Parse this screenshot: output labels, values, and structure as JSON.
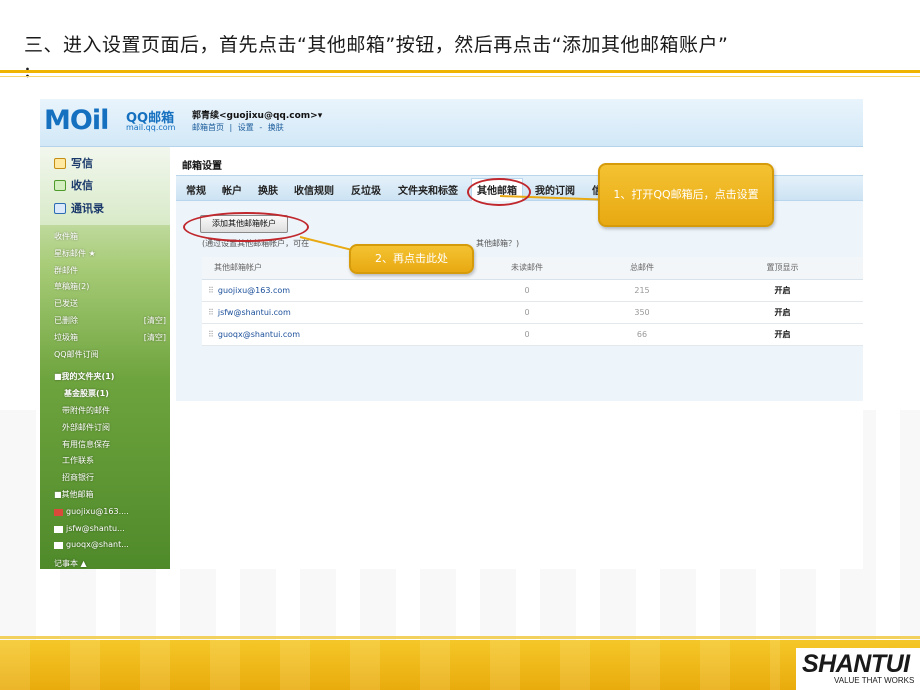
{
  "slide": {
    "title": "三、进入设置页面后，首先点击“其他邮箱”按钮，然后再点击“添加其他邮箱账户”",
    "title_tail": "："
  },
  "mail": {
    "logo_main": "MOil",
    "logo_qq": "QQ邮箱",
    "logo_domain": "mail.qq.com",
    "user_display": "郭青续<guojixu@qq.com>",
    "user_menu": "▾",
    "header_links": [
      "邮箱首页",
      "|",
      "设置",
      "-",
      "换肤"
    ],
    "sidebar": {
      "write": "写信",
      "receive": "收信",
      "contacts": "通讯录",
      "folders": [
        {
          "label": "收件箱",
          "right": ""
        },
        {
          "label": "星标邮件 ★",
          "right": ""
        },
        {
          "label": "群邮件",
          "right": ""
        },
        {
          "label": "草稿箱(2)",
          "right": ""
        },
        {
          "label": "已发送",
          "right": ""
        },
        {
          "label": "已删除",
          "right": "[清空]"
        },
        {
          "label": "垃圾箱",
          "right": "[清空]"
        },
        {
          "label": "QQ邮件订阅",
          "right": ""
        }
      ],
      "my_folders_title": "■我的文件夹(1)",
      "my_folders": [
        "基金股票(1)",
        "带附件的邮件",
        "外部邮件订阅",
        "有用信息保存",
        "工作联系",
        "招商银行"
      ],
      "other_mail_title": "■其他邮箱",
      "other_mail": [
        "guojixu@163....",
        "jsfw@shantu...",
        "guoqx@shant..."
      ],
      "bottom_item": "记事本 ▲"
    },
    "panel_title": "邮箱设置",
    "tabs": [
      "常规",
      "帐户",
      "换肤",
      "收信规则",
      "反垃圾",
      "文件夹和标签",
      "其他邮箱",
      "我的订阅",
      "信"
    ],
    "active_tab": "其他邮箱",
    "add_button": "添加其他邮箱帐户",
    "hint_text": "(通过设置其他邮箱帐户，可在",
    "hint_tail": "其他邮箱？)",
    "table": {
      "headers": [
        "其他邮箱帐户",
        "未读邮件",
        "总邮件",
        "置顶显示"
      ],
      "rows": [
        {
          "account": "guojixu@163.com",
          "unread": "0",
          "total": "215",
          "action": "开启"
        },
        {
          "account": "jsfw@shantui.com",
          "unread": "0",
          "total": "350",
          "action": "开启"
        },
        {
          "account": "guoqx@shantui.com",
          "unread": "0",
          "total": "66",
          "action": "开启"
        }
      ]
    }
  },
  "annotations": {
    "callout1": "1、打开QQ邮箱后，点击设置",
    "callout2": "2、再点击此处"
  },
  "footer": {
    "brand": "SHANTUI",
    "slogan": "VALUE THAT WORKS"
  },
  "colors": {
    "accent_yellow": "#f0b400",
    "callout_fill": "#e8a912",
    "ring_red": "#c0282d",
    "mail_blue": "#1570c0"
  }
}
